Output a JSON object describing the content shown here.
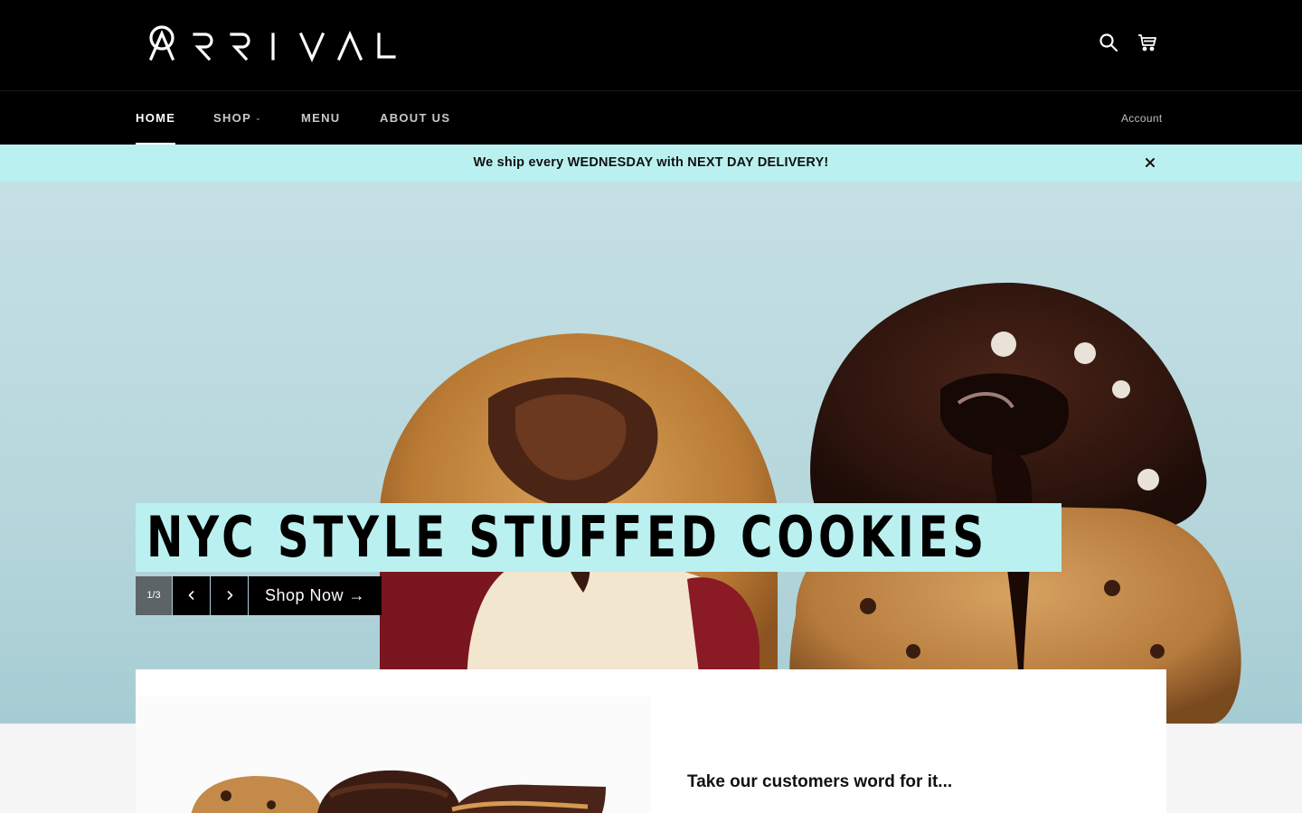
{
  "brand": {
    "name": "ARRIVAL"
  },
  "header": {
    "icons": [
      "search-icon",
      "cart-icon"
    ]
  },
  "nav": {
    "items": [
      {
        "label": "HOME",
        "active": true
      },
      {
        "label": "SHOP",
        "has_dropdown": true
      },
      {
        "label": "MENU"
      },
      {
        "label": "ABOUT US"
      }
    ],
    "account_label": "Account"
  },
  "announcement": {
    "text": "We ship every WEDNESDAY with NEXT DAY DELIVERY!",
    "background": "#baf1f0"
  },
  "hero": {
    "title": "NYC STYLE STUFFED COOKIES",
    "counter": "1/3",
    "cta_label": "Shop Now →",
    "accent": "#baf1f0"
  },
  "feature": {
    "heading": "Take our customers word for it..."
  }
}
